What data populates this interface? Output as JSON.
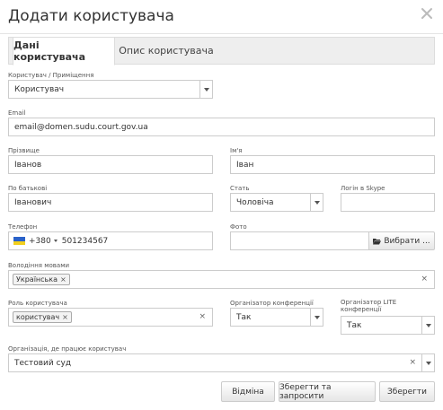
{
  "modal": {
    "title": "Додати користувача"
  },
  "tabs": [
    {
      "label": "Дані користувача",
      "active": true
    },
    {
      "label": "Опис користувача",
      "active": false
    }
  ],
  "form": {
    "user_type": {
      "label": "Користувач / Приміщення",
      "value": "Користувач"
    },
    "email": {
      "label": "Email",
      "value": "email@domen.sudu.court.gov.ua"
    },
    "last_name": {
      "label": "Прізвище",
      "value": "Іванов"
    },
    "first_name": {
      "label": "Ім'я",
      "value": "Іван"
    },
    "patronymic": {
      "label": "По батькові",
      "value": "Іванович"
    },
    "gender": {
      "label": "Стать",
      "value": "Чоловіча"
    },
    "skype": {
      "label": "Логін в Skype",
      "value": ""
    },
    "phone": {
      "label": "Телефон",
      "code": "+380",
      "value": "501234567"
    },
    "photo": {
      "label": "Фото",
      "value": "",
      "button": "Вибрати ..."
    },
    "languages": {
      "label": "Володіння мовами",
      "tags": [
        "Українська"
      ]
    },
    "role": {
      "label": "Роль користувача",
      "tags": [
        "користувач"
      ]
    },
    "conf_organizer": {
      "label": "Організатор конференції",
      "value": "Так"
    },
    "lite_organizer": {
      "label": "Організатор LITE конференції",
      "value": "Так"
    },
    "organization": {
      "label": "Організація, де працює користувач",
      "value": "Тестовий суд"
    }
  },
  "footer": {
    "cancel": "Відміна",
    "save_invite": "Зберегти та запросити",
    "save": "Зберегти"
  },
  "colors": {
    "flag_blue": "#2a62c9",
    "flag_yellow": "#f2cf1f",
    "border": "#cccccc",
    "tabs_bg": "#eeeeee"
  }
}
